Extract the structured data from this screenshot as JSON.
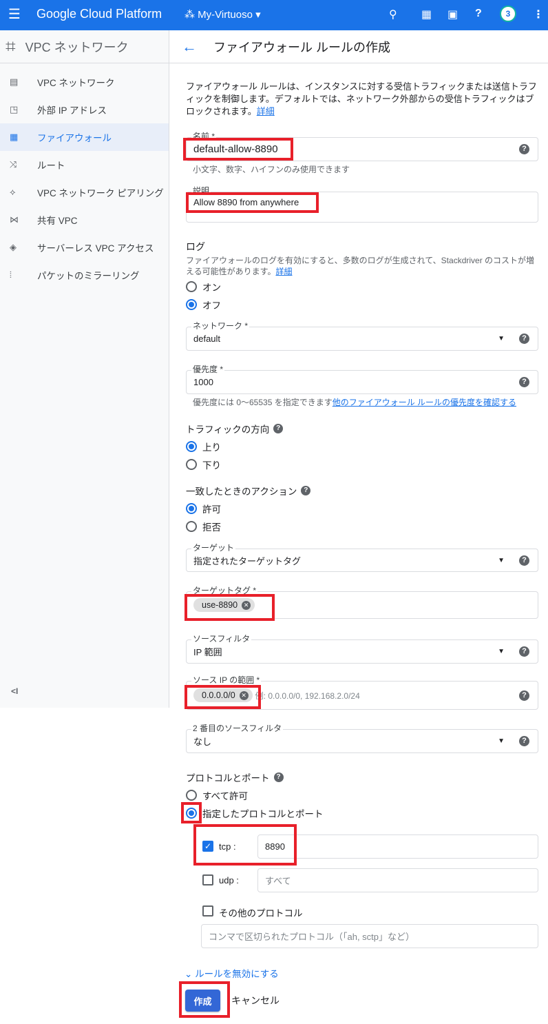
{
  "topbar": {
    "brand": "Google Cloud Platform",
    "project": "My-Virtuoso",
    "notifications": "3"
  },
  "sidebar": {
    "title": "VPC ネットワーク",
    "collapse": "<I",
    "items": [
      {
        "label": "VPC ネットワーク",
        "icon": "vpc-network-icon"
      },
      {
        "label": "外部 IP アドレス",
        "icon": "external-ip-icon"
      },
      {
        "label": "ファイアウォール",
        "icon": "firewall-icon",
        "active": true
      },
      {
        "label": "ルート",
        "icon": "route-icon"
      },
      {
        "label": "VPC ネットワーク ピアリング",
        "icon": "peering-icon"
      },
      {
        "label": "共有 VPC",
        "icon": "shared-vpc-icon"
      },
      {
        "label": "サーバーレス VPC アクセス",
        "icon": "serverless-icon"
      },
      {
        "label": "パケットのミラーリング",
        "icon": "mirroring-icon"
      }
    ]
  },
  "page": {
    "title": "ファイアウォール ルールの作成",
    "intro": "ファイアウォール ルールは、インスタンスに対する受信トラフィックまたは送信トラフィックを制御します。デフォルトでは、ネットワーク外部からの受信トラフィックはブロックされます。",
    "intro_link": "詳細"
  },
  "name": {
    "label": "名前 *",
    "value": "default-allow-8890",
    "hint": "小文字、数字、ハイフンのみ使用できます"
  },
  "description": {
    "label": "説明",
    "value": "Allow 8890 from anywhere"
  },
  "logs": {
    "label": "ログ",
    "text": "ファイアウォールのログを有効にすると、多数のログが生成されて、Stackdriver のコストが増える可能性があります。",
    "link": "詳細",
    "on": "オン",
    "off": "オフ"
  },
  "network": {
    "label": "ネットワーク *",
    "value": "default"
  },
  "priority": {
    "label": "優先度 *",
    "value": "1000",
    "hint": "優先度には 0〜65535 を指定できます",
    "hint_link": "他のファイアウォール ルールの優先度を確認する"
  },
  "direction": {
    "label": "トラフィックの方向",
    "ingress": "上り",
    "egress": "下り"
  },
  "action": {
    "label": "一致したときのアクション",
    "allow": "許可",
    "deny": "拒否"
  },
  "targets": {
    "label": "ターゲット",
    "value": "指定されたターゲットタグ"
  },
  "target_tags": {
    "label": "ターゲットタグ *",
    "chip": "use-8890"
  },
  "source_filter": {
    "label": "ソースフィルタ",
    "value": "IP 範囲"
  },
  "source_ip": {
    "label": "ソース IP の範囲 *",
    "chip": "0.0.0.0/0",
    "placeholder": "例: 0.0.0.0/0, 192.168.2.0/24"
  },
  "second_filter": {
    "label": "2 番目のソースフィルタ",
    "value": "なし"
  },
  "protocols": {
    "label": "プロトコルとポート",
    "allow_all": "すべて許可",
    "specified": "指定したプロトコルとポート",
    "tcp_label": "tcp :",
    "tcp_value": "8890",
    "udp_label": "udp :",
    "udp_placeholder": "すべて",
    "other_label": "その他のプロトコル",
    "other_placeholder": "コンマで区切られたプロトコル（「ah, sctp」など）"
  },
  "disable_rule": "ルールを無効にする",
  "buttons": {
    "create": "作成",
    "cancel": "キャンセル"
  }
}
